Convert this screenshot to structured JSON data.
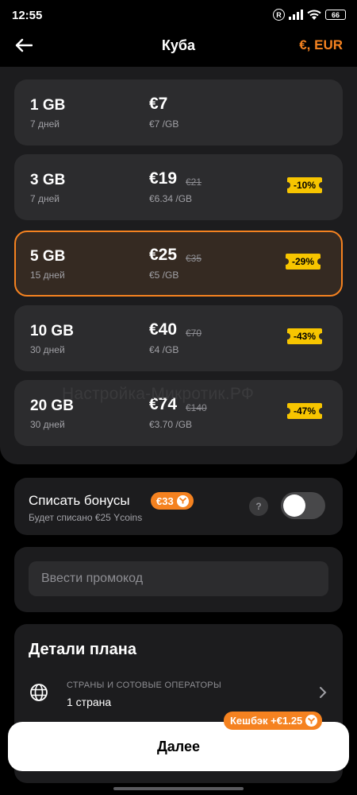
{
  "status_bar": {
    "time": "12:55",
    "registered_mark": "R",
    "battery": "66"
  },
  "header": {
    "title": "Куба",
    "currency": "€, EUR",
    "icons": {
      "back": "arrow-left-icon"
    }
  },
  "plans": [
    {
      "gb": "1 GB",
      "days": "7 дней",
      "price": "€7",
      "old_price": "",
      "per_gb": "€7 /GB",
      "discount": "",
      "selected": false
    },
    {
      "gb": "3 GB",
      "days": "7 дней",
      "price": "€19",
      "old_price": "€21",
      "per_gb": "€6.34 /GB",
      "discount": "-10%",
      "selected": false
    },
    {
      "gb": "5 GB",
      "days": "15 дней",
      "price": "€25",
      "old_price": "€35",
      "per_gb": "€5 /GB",
      "discount": "-29%",
      "selected": true
    },
    {
      "gb": "10 GB",
      "days": "30 дней",
      "price": "€40",
      "old_price": "€70",
      "per_gb": "€4 /GB",
      "discount": "-43%",
      "selected": false
    },
    {
      "gb": "20 GB",
      "days": "30 дней",
      "price": "€74",
      "old_price": "€140",
      "per_gb": "€3.70 /GB",
      "discount": "-47%",
      "selected": false
    }
  ],
  "watermark": "Настройка-Микротик.РФ",
  "bonus": {
    "title": "Списать бонусы",
    "chip_value": "€33",
    "subtitle": "Будет списано €25 Ycoins",
    "help": "?",
    "toggle_on": false
  },
  "promo": {
    "placeholder": "Ввести промокод",
    "value": ""
  },
  "details": {
    "title": "Детали плана",
    "countries_label": "СТРАНЫ И СОТОВЫЕ ОПЕРАТОРЫ",
    "countries_value": "1 страна",
    "icons": {
      "globe": "globe-icon",
      "chevron": "chevron-right-icon"
    }
  },
  "footer": {
    "cashback": "Кешбэк +€1.25",
    "next_label": "Далее"
  },
  "colors": {
    "accent": "#f58220",
    "badge": "#f7c500",
    "card": "#2c2c2e",
    "panel": "#1c1c1e"
  }
}
